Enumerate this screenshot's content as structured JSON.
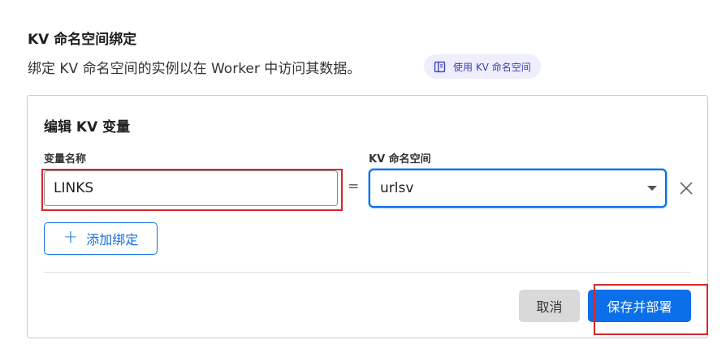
{
  "section": {
    "title": "KV 命名空间绑定",
    "description": "绑定 KV 命名空间的实例以在 Worker 中访问其数据。",
    "docs_link": {
      "label": "使用 KV 命名空间",
      "icon": "book-icon"
    }
  },
  "card": {
    "title": "编辑 KV 变量",
    "variable_label": "变量名称",
    "namespace_label": "KV 命名空间",
    "variable_value": "LINKS",
    "equals": "=",
    "namespace_value": "urlsv",
    "add_binding_label": "添加绑定",
    "cancel_label": "取消",
    "save_label": "保存并部署"
  },
  "colors": {
    "accent": "#0a6fe8",
    "highlight": "#d8262d",
    "pill_bg": "#eeeefc"
  }
}
